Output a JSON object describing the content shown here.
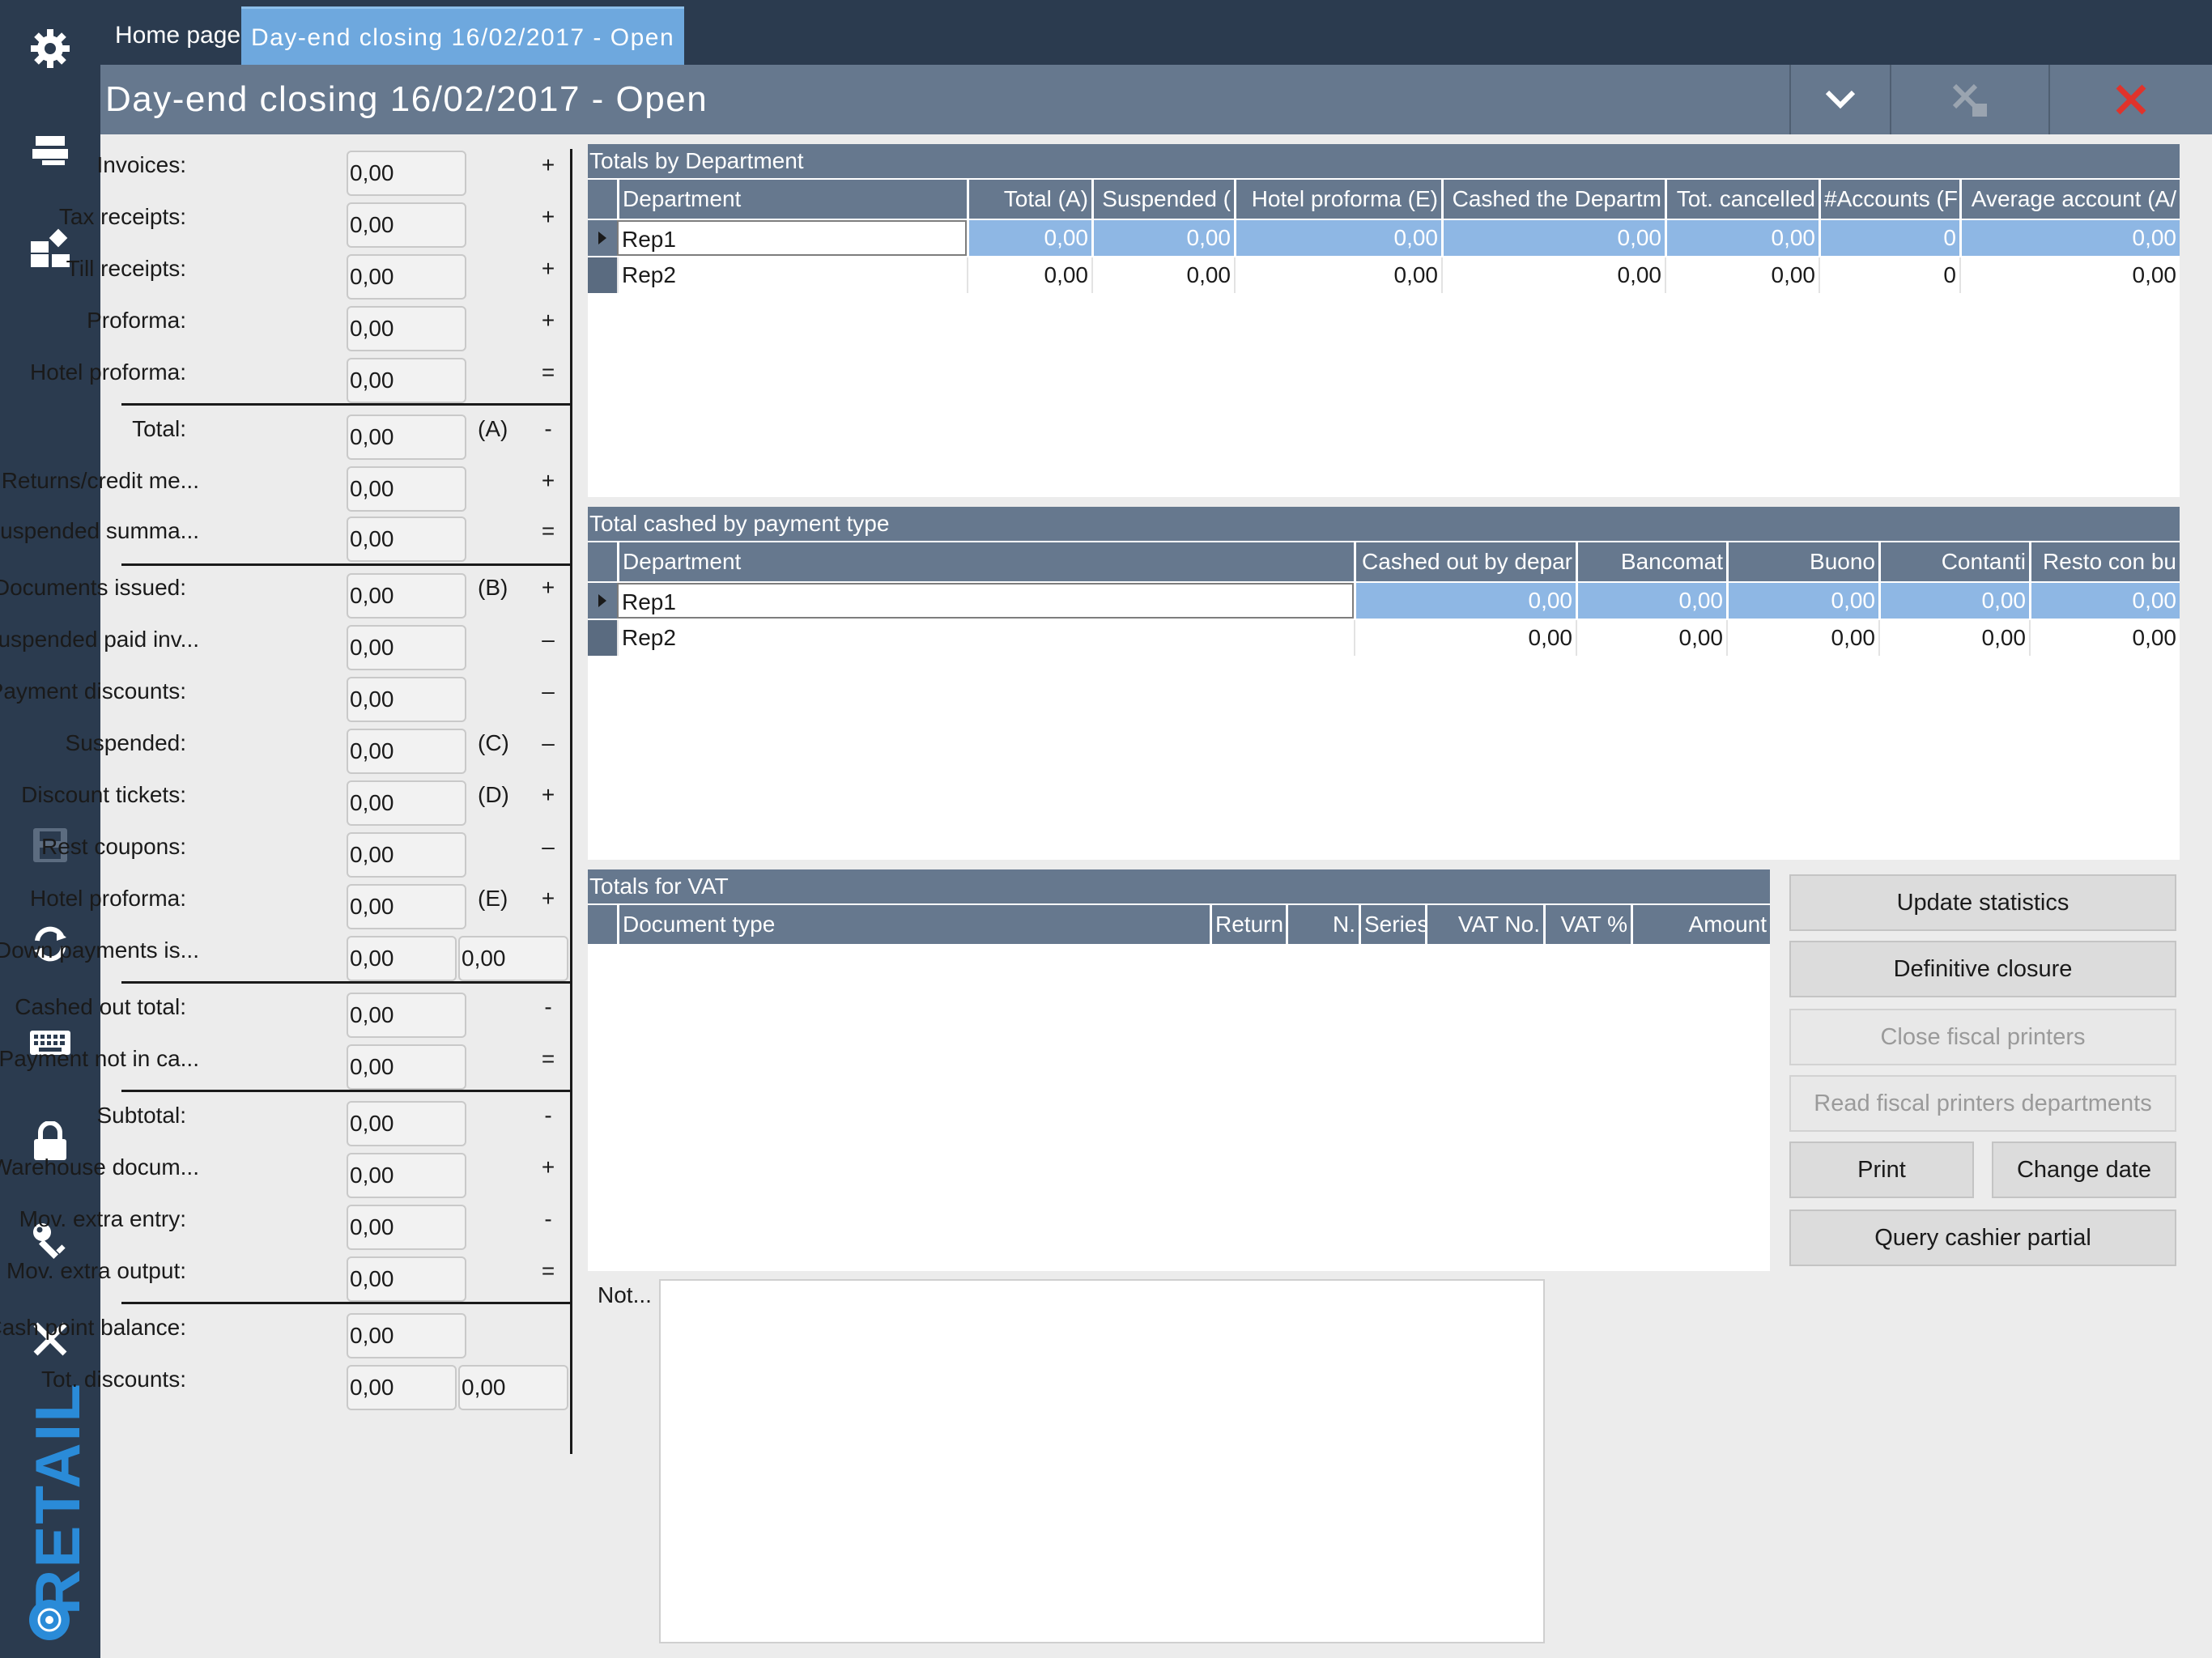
{
  "tabs": {
    "home": "Home page",
    "active": "Day-end closing 16/02/2017 - Open"
  },
  "title": "Day-end closing 16/02/2017 - Open",
  "sidebar": {
    "brand": "RETAIL",
    "icons": [
      "gear-icon",
      "register-icon",
      "dashboard-icon",
      "save-icon",
      "sync-icon",
      "keyboard-icon",
      "lock-icon",
      "key-icon",
      "close-icon"
    ]
  },
  "form": {
    "rows": [
      {
        "label": "Invoices:",
        "value": "0,00",
        "tag": "",
        "op": "+"
      },
      {
        "label": "Tax receipts:",
        "value": "0,00",
        "tag": "",
        "op": "+"
      },
      {
        "label": "Till receipts:",
        "value": "0,00",
        "tag": "",
        "op": "+"
      },
      {
        "label": "Proforma:",
        "value": "0,00",
        "tag": "",
        "op": "+"
      },
      {
        "label": "Hotel proforma:",
        "value": "0,00",
        "tag": "",
        "op": "="
      },
      {
        "label": "Total:",
        "value": "0,00",
        "tag": "(A)",
        "op": "-"
      },
      {
        "label": "Returns/credit me...",
        "value": "0,00",
        "tag": "",
        "op": "+"
      },
      {
        "label": "Suspended summa...",
        "value": "0,00",
        "tag": "",
        "op": "="
      },
      {
        "label": "Documents issued:",
        "value": "0,00",
        "tag": "(B)",
        "op": "+"
      },
      {
        "label": "Suspended paid inv...",
        "value": "0,00",
        "tag": "",
        "op": "–"
      },
      {
        "label": "Payment discounts:",
        "value": "0,00",
        "tag": "",
        "op": "–"
      },
      {
        "label": "Suspended:",
        "value": "0,00",
        "tag": "(C)",
        "op": "–"
      },
      {
        "label": "Discount tickets:",
        "value": "0,00",
        "tag": "(D)",
        "op": "+"
      },
      {
        "label": "Rest coupons:",
        "value": "0,00",
        "tag": "",
        "op": "–"
      },
      {
        "label": "Hotel proforma:",
        "value": "0,00",
        "tag": "(E)",
        "op": "+"
      },
      {
        "label": "Down payments is...",
        "value": "0,00",
        "value2": "0,00",
        "tag": "",
        "op": ""
      },
      {
        "label": "Cashed out total:",
        "value": "0,00",
        "tag": "",
        "op": "-"
      },
      {
        "label": "Payment not in ca...",
        "value": "0,00",
        "tag": "",
        "op": "="
      },
      {
        "label": "Subtotal:",
        "value": "0,00",
        "tag": "",
        "op": "-"
      },
      {
        "label": "Warehouse docum...",
        "value": "0,00",
        "tag": "",
        "op": "+"
      },
      {
        "label": "Mov. extra entry:",
        "value": "0,00",
        "tag": "",
        "op": "-"
      },
      {
        "label": "Mov. extra output:",
        "value": "0,00",
        "tag": "",
        "op": "="
      },
      {
        "label": "Cash point balance:",
        "value": "0,00",
        "tag": "",
        "op": ""
      },
      {
        "label": "Tot. discounts:",
        "value": "0,00",
        "value2": "0,00",
        "tag": "",
        "op": ""
      }
    ]
  },
  "dept_panel": {
    "title": "Totals by Department",
    "columns": [
      "Department",
      "Total (A)",
      "Suspended (",
      "Hotel proforma (E)",
      "Cashed the Departm",
      "Tot. cancelled",
      "#Accounts (F",
      "Average account (A/"
    ],
    "rows": [
      [
        "Rep1",
        "0,00",
        "0,00",
        "0,00",
        "0,00",
        "0,00",
        "0",
        "0,00"
      ],
      [
        "Rep2",
        "0,00",
        "0,00",
        "0,00",
        "0,00",
        "0,00",
        "0",
        "0,00"
      ]
    ]
  },
  "pay_panel": {
    "title": "Total cashed by payment type",
    "columns": [
      "Department",
      "Cashed out by depar",
      "Bancomat",
      "Buono",
      "Contanti",
      "Resto con bu"
    ],
    "rows": [
      [
        "Rep1",
        "0,00",
        "0,00",
        "0,00",
        "0,00",
        "0,00"
      ],
      [
        "Rep2",
        "0,00",
        "0,00",
        "0,00",
        "0,00",
        "0,00"
      ]
    ]
  },
  "vat_panel": {
    "title": "Totals for VAT",
    "columns": [
      "Document type",
      "Return",
      "N.",
      "Series",
      "VAT No.",
      "VAT %",
      "Amount"
    ]
  },
  "buttons": {
    "update_statistics": "Update statistics",
    "definitive_closure": "Definitive closure",
    "close_fiscal_printers": "Close fiscal printers",
    "read_fiscal_departments": "Read fiscal printers departments",
    "print": "Print",
    "change_date": "Change date",
    "query_cashier_partial": "Query cashier partial"
  },
  "notes": {
    "label": "Not...",
    "value": ""
  },
  "colors": {
    "sidebar": "#2b3b4f",
    "header": "#66788e",
    "accent": "#6ea8de",
    "close_red": "#e0332b",
    "selection": "#8eb7e4"
  }
}
